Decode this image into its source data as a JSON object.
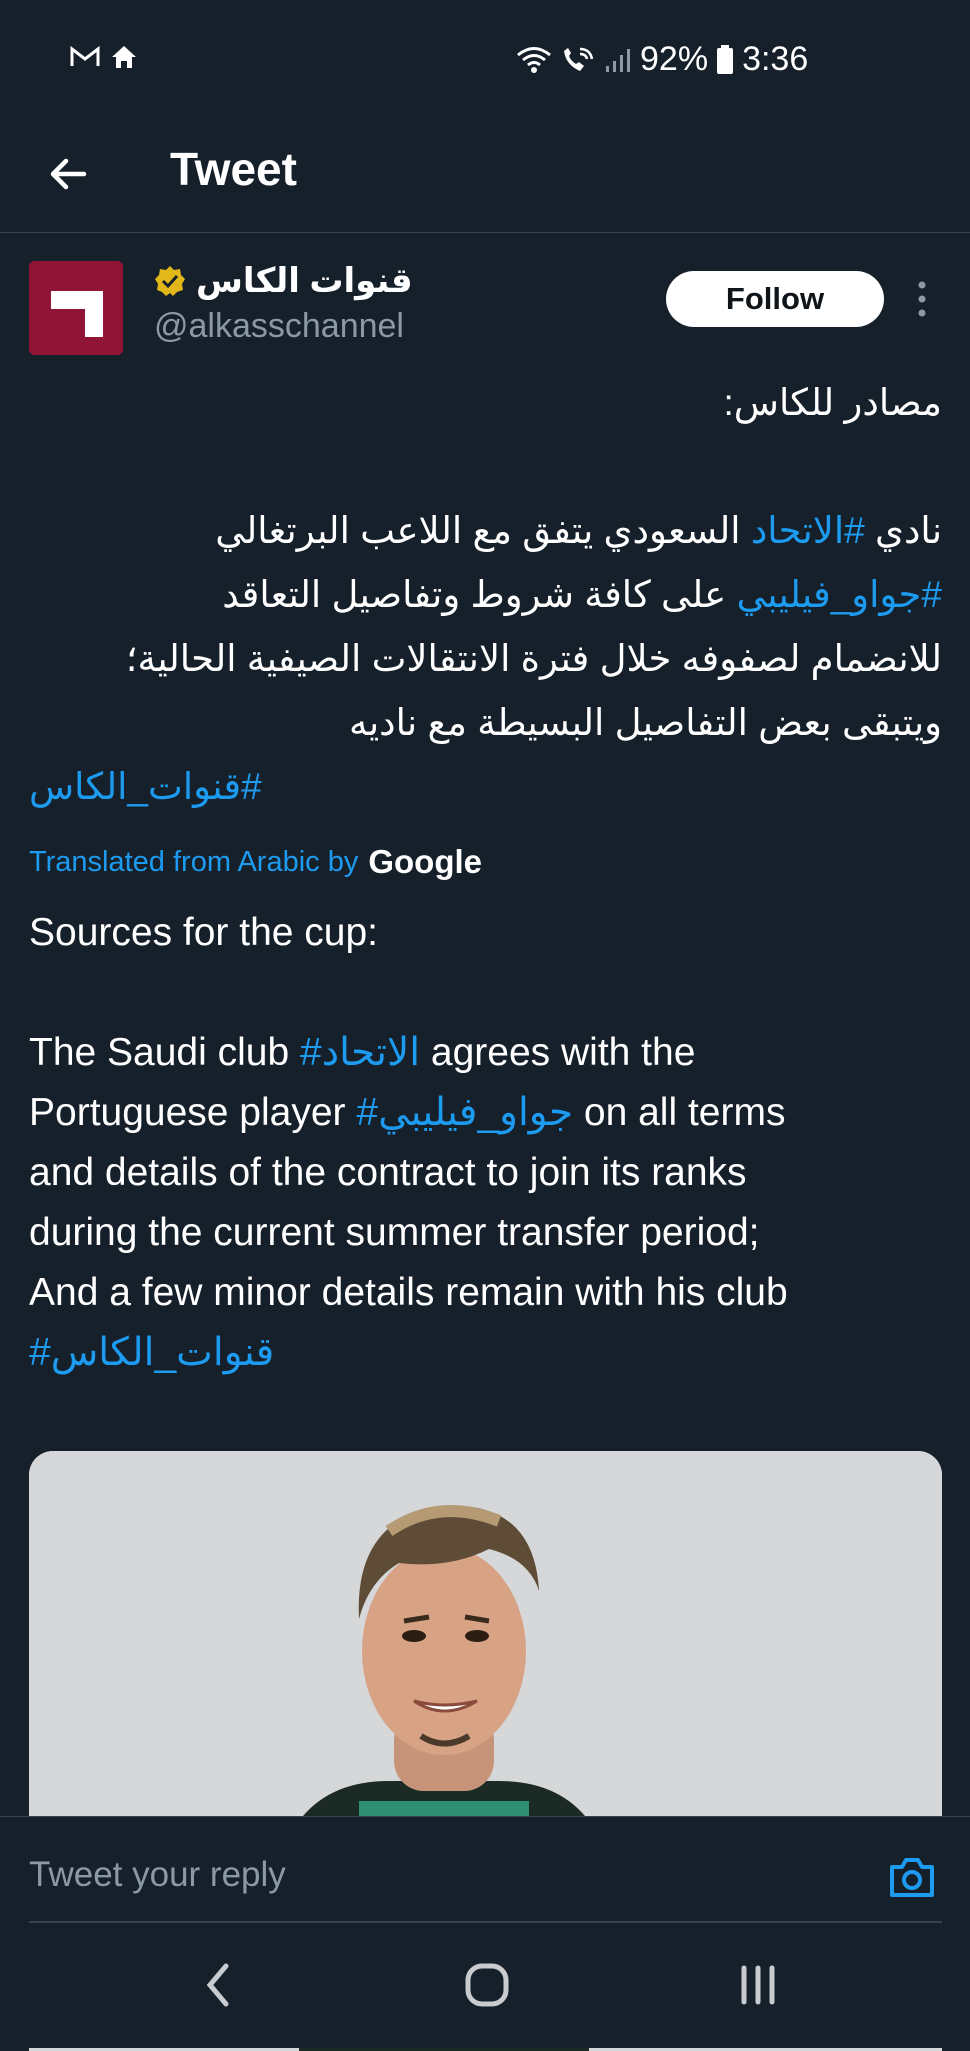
{
  "status_bar": {
    "battery": "92%",
    "time": "3:36"
  },
  "app_bar": {
    "title": "Tweet"
  },
  "tweet": {
    "author_name": "قنوات الكاس",
    "handle": "@alkasschannel",
    "follow_label": "Follow",
    "arabic_lines": [
      {
        "text": "مصادر للكاس:"
      },
      {
        "text": ""
      },
      {
        "pre": "نادي ",
        "tag": "#الاتحاد",
        "post": " السعودي يتفق مع اللاعب البرتغالي"
      },
      {
        "tag": "#جواو_فيليبي",
        "post": " على كافة شروط وتفاصيل التعاقد"
      },
      {
        "text": "للانضمام لصفوفه خلال فترة الانتقالات الصيفية الحالية؛"
      },
      {
        "text": "ويتبقى بعض التفاصيل البسيطة مع ناديه"
      },
      {
        "tag": "#قنوات_الكاس"
      }
    ],
    "translated_label": "Translated from Arabic by",
    "translated_brand": "Google",
    "english": {
      "line1": "Sources for the cup:",
      "p2_a": "The Saudi club ",
      "p2_tag1": "#الاتحاد",
      "p2_b": " agrees with the",
      "p3_a": "Portuguese player ",
      "p3_tag2": "#جواو_فيليبي",
      "p3_b": " on all terms",
      "line4": "and details of the contract to join its ranks",
      "line5": "during the current summer transfer period;",
      "line6": "And a few minor details remain with his club",
      "tag3": "#قنوات_الكاس"
    }
  },
  "reply": {
    "placeholder": "Tweet your reply"
  },
  "colors": {
    "background": "#15202b",
    "link": "#1d9bf0",
    "secondary_text": "#8b98a5",
    "verified_badge": "#e2b719",
    "avatar": "#8f1435"
  }
}
